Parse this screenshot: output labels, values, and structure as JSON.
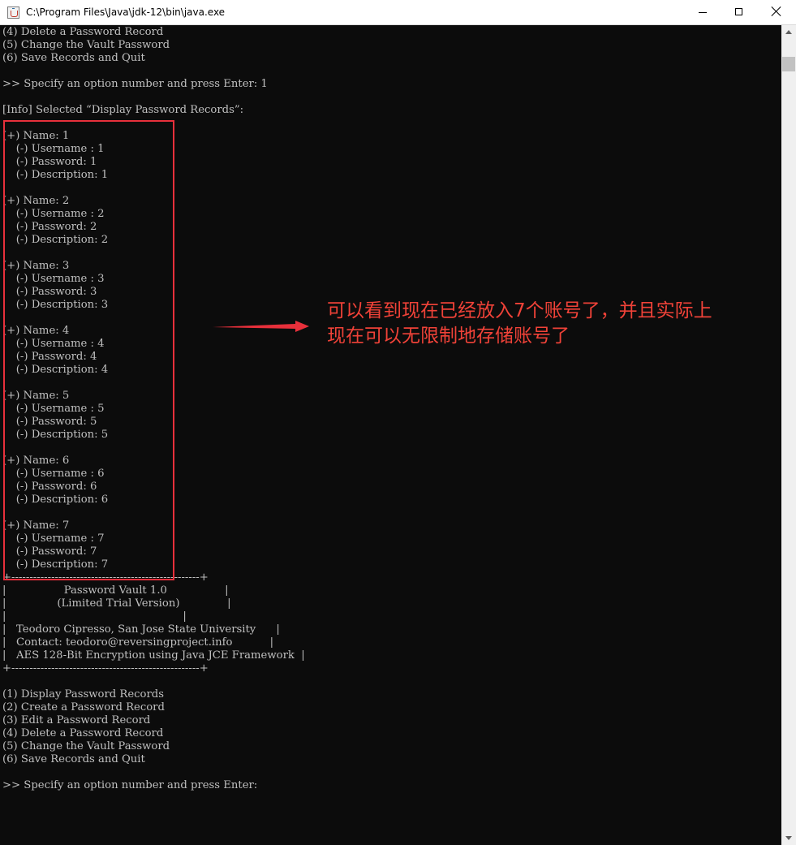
{
  "window": {
    "title": "C:\\Program Files\\Java\\jdk-12\\bin\\java.exe"
  },
  "console": {
    "lines": [
      "(4) Delete a Password Record",
      "(5) Change the Vault Password",
      "(6) Save Records and Quit",
      "",
      ">> Specify an option number and press Enter: 1",
      "",
      "[Info] Selected “Display Password Records”:",
      "",
      "(+) Name: 1",
      "    (-) Username : 1",
      "    (-) Password: 1",
      "    (-) Description: 1",
      "",
      "(+) Name: 2",
      "    (-) Username : 2",
      "    (-) Password: 2",
      "    (-) Description: 2",
      "",
      "(+) Name: 3",
      "    (-) Username : 3",
      "    (-) Password: 3",
      "    (-) Description: 3",
      "",
      "(+) Name: 4",
      "    (-) Username : 4",
      "    (-) Password: 4",
      "    (-) Description: 4",
      "",
      "(+) Name: 5",
      "    (-) Username : 5",
      "    (-) Password: 5",
      "    (-) Description: 5",
      "",
      "(+) Name: 6",
      "    (-) Username : 6",
      "    (-) Password: 6",
      "    (-) Description: 6",
      "",
      "(+) Name: 7",
      "    (-) Username : 7",
      "    (-) Password: 7",
      "    (-) Description: 7",
      "+----------------------------------------------------+",
      "|                 Password Vault 1.0                 |",
      "|               (Limited Trial Version)              |",
      "|                                                    |",
      "|   Teodoro Cipresso, San Jose State University      |",
      "|   Contact: teodoro@reversingproject.info           |",
      "|   AES 128-Bit Encryption using Java JCE Framework  |",
      "+----------------------------------------------------+",
      "",
      "(1) Display Password Records",
      "(2) Create a Password Record",
      "(3) Edit a Password Record",
      "(4) Delete a Password Record",
      "(5) Change the Vault Password",
      "(6) Save Records and Quit",
      "",
      ">> Specify an option number and press Enter:"
    ]
  },
  "annotation": {
    "line1": "可以看到现在已经放入7个账号了，并且实际上",
    "line2": "现在可以无限制地存储账号了",
    "color": "#f04238"
  },
  "colors": {
    "console_bg": "#0c0c0c",
    "console_text": "#c0c0c0",
    "highlight_border": "#e8303b"
  },
  "icons": {
    "app": "java-app-icon",
    "minimize": "minimize-icon",
    "maximize": "maximize-icon",
    "close": "close-icon",
    "scroll_up": "scroll-up-arrow-icon",
    "scroll_down": "scroll-down-arrow-icon"
  }
}
